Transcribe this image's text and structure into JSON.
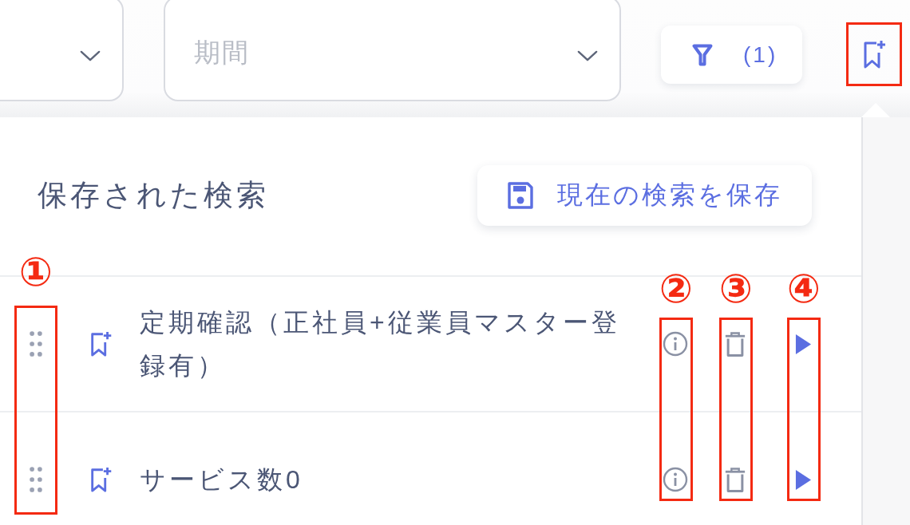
{
  "toolbar": {
    "dropdowns": [
      {
        "kind": "select"
      },
      {
        "kind": "select",
        "placeholder": "期間"
      }
    ],
    "filter_button": {
      "count": "(1)"
    },
    "saved_searches_button": {
      "highlighted": true,
      "expanded": true
    }
  },
  "saved_searches_panel": {
    "title": "保存された検索",
    "save_button": {
      "label": "現在の検索を保存"
    },
    "items": [
      {
        "name": "定期確認（正社員+従業員マスター登録有）"
      },
      {
        "name": "サービス数0"
      }
    ]
  },
  "annotations": [
    {
      "label": "①",
      "framed": true
    },
    {
      "label": "②",
      "framed": true
    },
    {
      "label": "③",
      "framed": true
    },
    {
      "label": "④",
      "framed": true
    }
  ]
}
